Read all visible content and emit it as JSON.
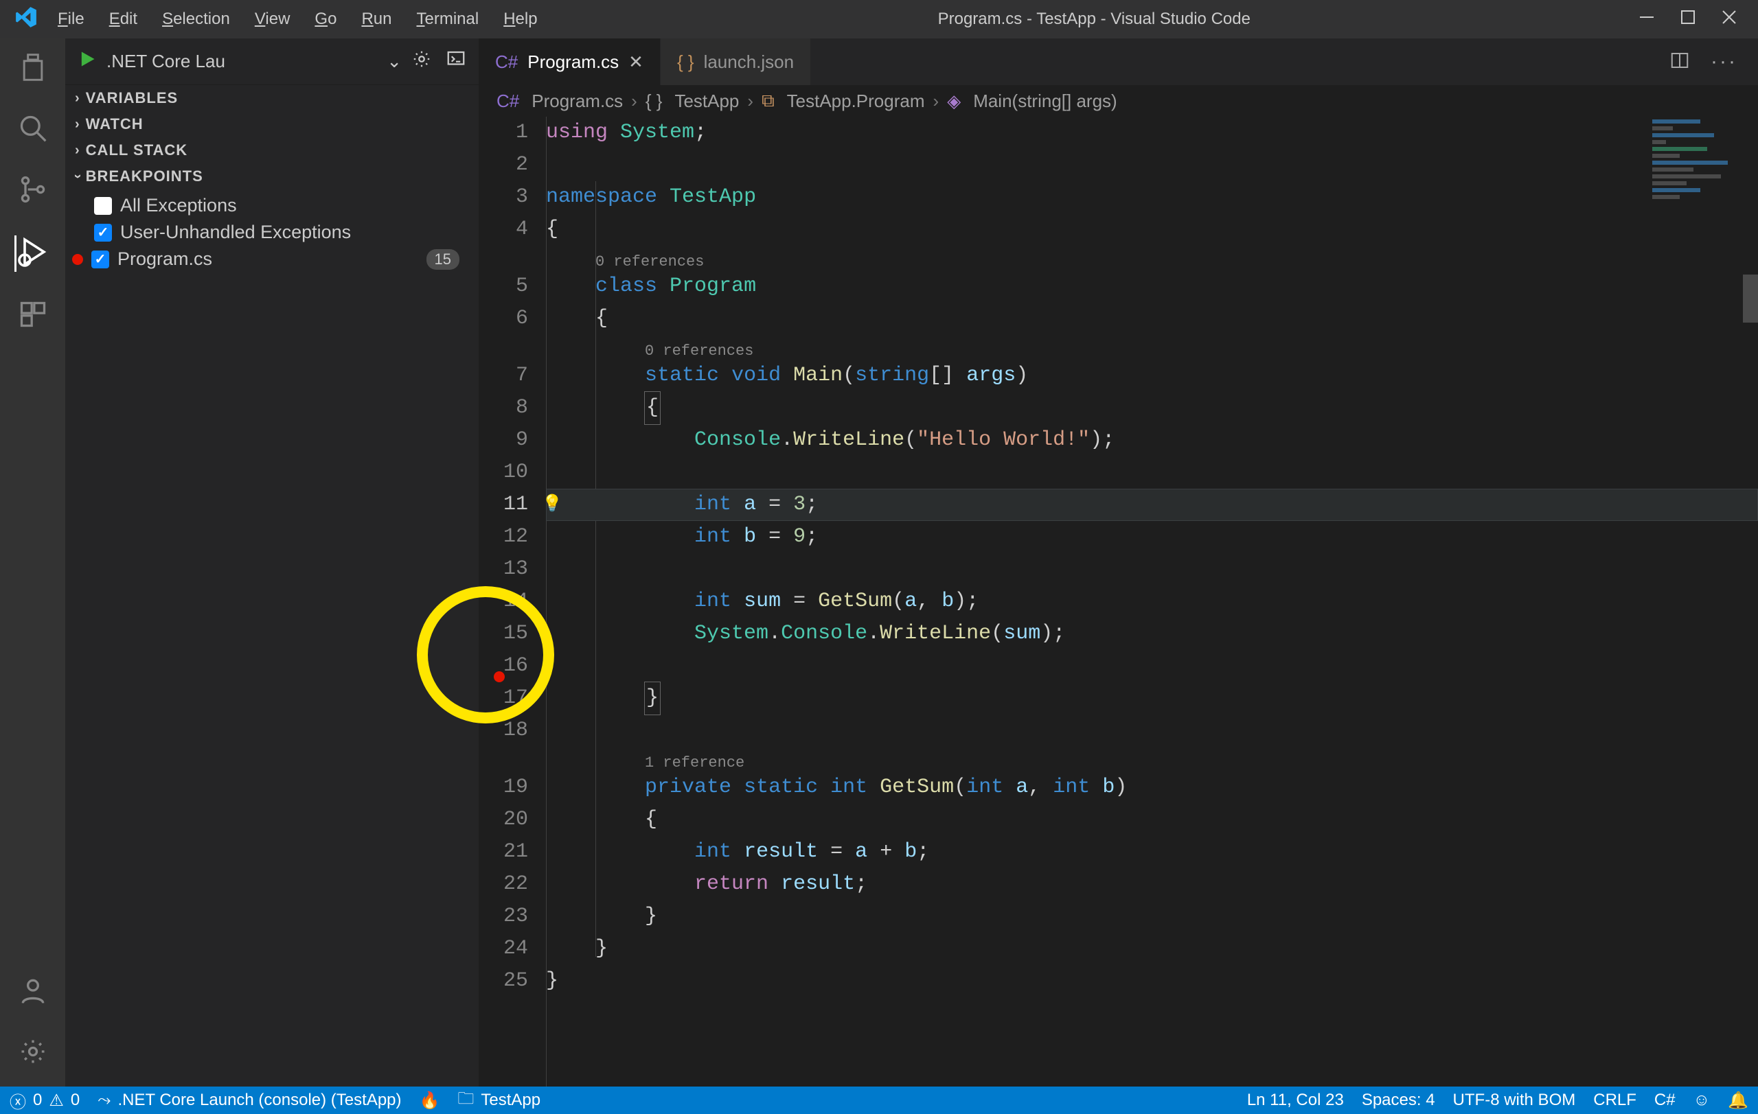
{
  "window": {
    "title": "Program.cs - TestApp - Visual Studio Code"
  },
  "menu": {
    "items": [
      "File",
      "Edit",
      "Selection",
      "View",
      "Go",
      "Run",
      "Terminal",
      "Help"
    ]
  },
  "debug_toolbar": {
    "config": ".NET Core Lau"
  },
  "sidebar": {
    "sections": {
      "variables": "VARIABLES",
      "watch": "WATCH",
      "callstack": "CALL STACK",
      "breakpoints": "BREAKPOINTS"
    },
    "bp_items": {
      "all_ex": {
        "label": "All Exceptions",
        "checked": false
      },
      "user_ex": {
        "label": "User-Unhandled Exceptions",
        "checked": true
      },
      "file_bp": {
        "label": "Program.cs",
        "checked": true,
        "line_badge": "15"
      }
    }
  },
  "tabs": {
    "active": {
      "label": "Program.cs"
    },
    "other": {
      "label": "launch.json"
    }
  },
  "breadcrumb": {
    "a": "Program.cs",
    "b": "TestApp",
    "c": "TestApp.Program",
    "d": "Main(string[] args)"
  },
  "editor": {
    "refs": {
      "zero": "0 references",
      "one": "1 reference"
    },
    "lines": {
      "1": "using System;",
      "2": "",
      "3": "namespace TestApp",
      "4": "{",
      "5": "    class Program",
      "6": "    {",
      "7": "        static void Main(string[] args)",
      "8": "        {",
      "9": "            Console.WriteLine(\"Hello World!\");",
      "10": "",
      "11": "            int a = 3;",
      "12": "            int b = 9;",
      "13": "",
      "14": "            int sum = GetSum(a, b);",
      "15": "            System.Console.WriteLine(sum);",
      "16": "",
      "17": "        }",
      "18": "",
      "19": "        private static int GetSum(int a, int b)",
      "20": "        {",
      "21": "            int result = a + b;",
      "22": "            return result;",
      "23": "        }",
      "24": "    }",
      "25": "}"
    },
    "current_line": 11,
    "breakpoint_line": 15
  },
  "status": {
    "errors": "0",
    "warnings": "0",
    "launch": ".NET Core Launch (console) (TestApp)",
    "folder": "TestApp",
    "pos": "Ln 11, Col 23",
    "spaces": "Spaces: 4",
    "encoding": "UTF-8 with BOM",
    "eol": "CRLF",
    "lang": "C#"
  }
}
